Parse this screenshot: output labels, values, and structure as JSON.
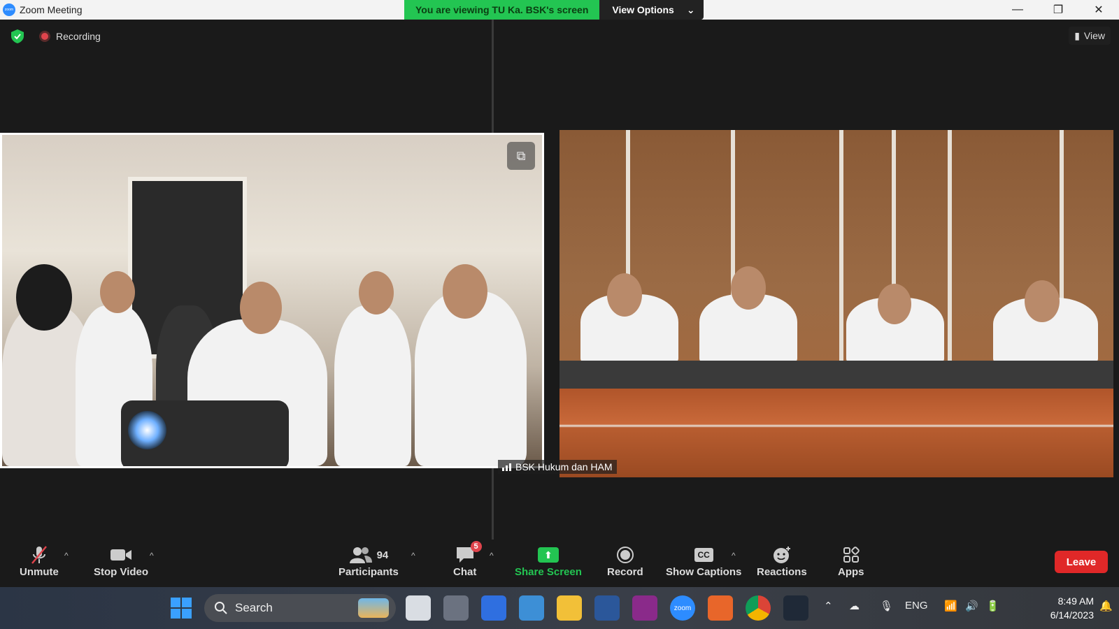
{
  "window": {
    "title": "Zoom Meeting",
    "minimize": "—",
    "restore": "❐",
    "close": "✕"
  },
  "share_banner": {
    "status": "You are viewing TU Ka. BSK's screen",
    "view_options": "View Options",
    "chevron": "⌄"
  },
  "meeting": {
    "recording_label": "Recording",
    "view_label": "View",
    "right_video_name": "BSK Hukum dan HAM"
  },
  "toolbar": {
    "unmute": "Unmute",
    "stop_video": "Stop Video",
    "participants": "Participants",
    "participants_count": "94",
    "chat": "Chat",
    "chat_badge": "5",
    "share_screen": "Share Screen",
    "record": "Record",
    "show_captions": "Show Captions",
    "captions_glyph": "CC",
    "reactions": "Reactions",
    "apps": "Apps",
    "leave": "Leave",
    "caret": "^"
  },
  "taskbar": {
    "search_placeholder": "Search",
    "tray_lang": "ENG",
    "time": "8:49 AM",
    "date": "6/14/2023",
    "zoom_app": "zoom"
  },
  "colors": {
    "accent_green": "#23c552",
    "leave_red": "#e02828",
    "badge_red": "#e0444c",
    "zoom_blue": "#2d8cff"
  }
}
